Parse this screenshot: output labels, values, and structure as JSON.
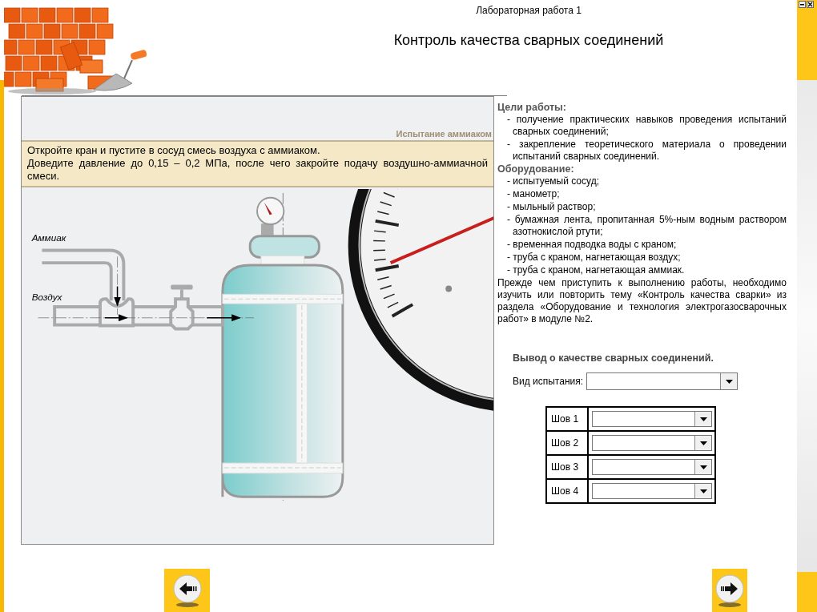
{
  "header": {
    "subtitle": "Лабораторная работа 1",
    "title": "Контроль качества сварных соединений"
  },
  "step": {
    "caption": "Испытание аммиаком",
    "instructions": [
      "Откройте кран и пустите в сосуд смесь воздуха с аммиаком.",
      "Доведите давление до 0,15 – 0,2 МПа, после чего закройте подачу воздушно-аммиачной смеси."
    ]
  },
  "diagram": {
    "labels": [
      "Аммиак",
      "Воздух"
    ]
  },
  "info": {
    "sections": [
      {
        "heading": "Цели работы:",
        "items": [
          "- получение практических навыков проведения испытаний сварных соединений;",
          "- закрепление теоретического материала о проведении испытаний сварных соединений."
        ]
      },
      {
        "heading": "Оборудование:",
        "items": [
          "- испытуемый сосуд;",
          "- манометр;",
          "- мыльный раствор;",
          "- бумажная лента, пропитанная 5%-ным водным раствором азотнокислой ртути;",
          "- временная подводка воды с краном;",
          "- труба с краном, нагнетающая воздух;",
          "- труба с краном, нагнетающая аммиак."
        ]
      }
    ],
    "note": "Прежде чем приступить к выполнению работы, необходимо изучить или повторить тему «Контроль качества сварки»  из раздела  «Оборудование и технология электрогазосварочных работ»  в модуле №2."
  },
  "conclusion": {
    "heading": "Вывод о качестве сварных соединений.",
    "test_type": {
      "label": "Вид испытания:"
    },
    "seams": [
      {
        "label": "Шов 1"
      },
      {
        "label": "Шов 2"
      },
      {
        "label": "Шов 3"
      },
      {
        "label": "Шов 4"
      }
    ]
  }
}
